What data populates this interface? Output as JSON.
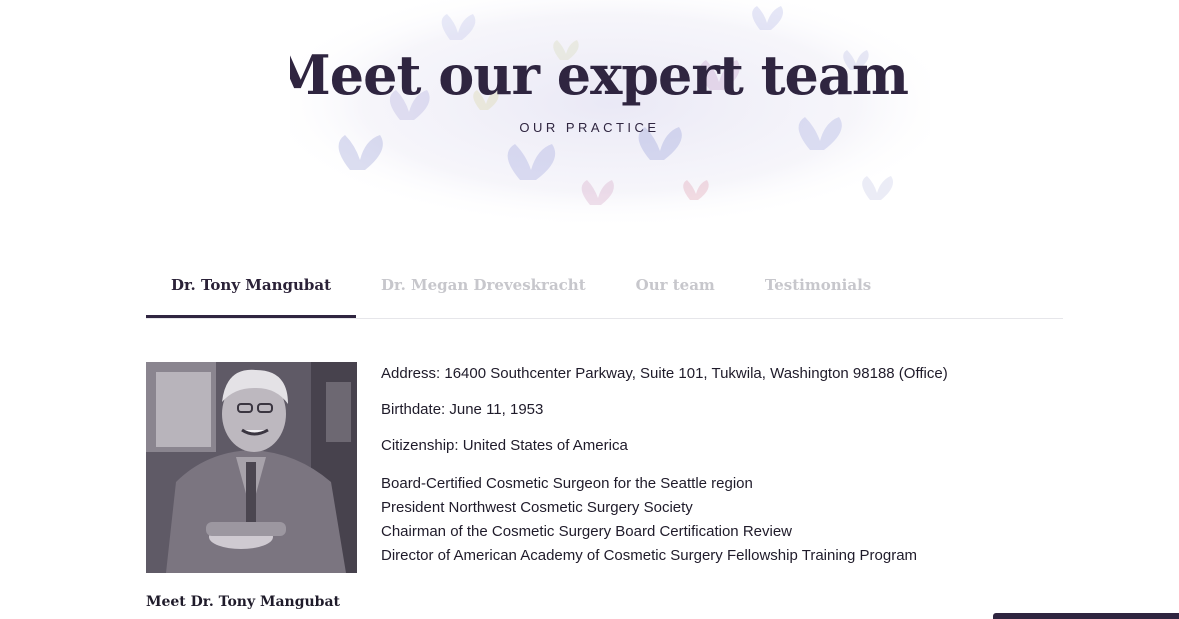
{
  "hero": {
    "title": "Meet our expert team",
    "subtitle": "OUR PRACTICE"
  },
  "tabs": [
    {
      "label": "Dr. Tony Mangubat",
      "active": true
    },
    {
      "label": "Dr. Megan Dreveskracht",
      "active": false
    },
    {
      "label": "Our team",
      "active": false
    },
    {
      "label": "Testimonials",
      "active": false
    }
  ],
  "profile": {
    "caption": "Meet Dr. Tony Mangubat",
    "address": "Address: 16400 Southcenter Parkway, Suite 101, Tukwila, Washington 98188 (Office)",
    "birthdate": "Birthdate: June 11, 1953",
    "citizenship": "Citizenship: United States of America",
    "credentials": [
      "Board-Certified Cosmetic Surgeon for the Seattle region",
      "President Northwest Cosmetic Surgery Society",
      "Chairman of the Cosmetic Surgery Board Certification Review",
      "Director of American Academy of Cosmetic Surgery Fellowship Training Program"
    ]
  },
  "colors": {
    "accent": "#2f2540",
    "tab_inactive": "#c7c7cc",
    "text": "#1f1b2a"
  }
}
